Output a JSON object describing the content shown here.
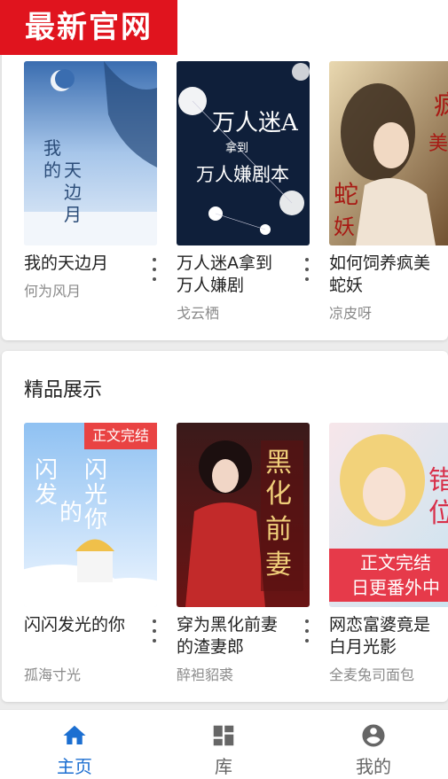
{
  "watermark": "最新官网",
  "sections": [
    {
      "title": "",
      "books": [
        {
          "title": "我的天边月",
          "author": "何为风月",
          "cover_text": "我的天边月"
        },
        {
          "title": "万人迷A拿到万人嫌剧",
          "author": "戈云栖",
          "cover_text": "万人迷A拿到万人嫌剧本"
        },
        {
          "title": "如何饲养疯美蛇妖",
          "author": "凉皮呀",
          "cover_text": "疯美蛇妖"
        }
      ]
    },
    {
      "title": "精品展示",
      "books": [
        {
          "title": "闪闪发光的你",
          "author": "孤海寸光",
          "cover_text": "闪闪发光的你",
          "badge": "正文完结"
        },
        {
          "title": "穿为黑化前妻的渣妻郎",
          "author": "醉袒貂裘",
          "cover_text": "黑化前妻"
        },
        {
          "title": "网恋富婆竟是白月光影",
          "author": "全麦兔司面包",
          "cover_text": "错位",
          "banner": [
            "正文完结",
            "日更番外中"
          ]
        }
      ]
    }
  ],
  "nav": {
    "home": "主页",
    "library": "库",
    "profile": "我的"
  },
  "colors": {
    "accent": "#1c6fd1",
    "watermark": "#e0141e"
  }
}
